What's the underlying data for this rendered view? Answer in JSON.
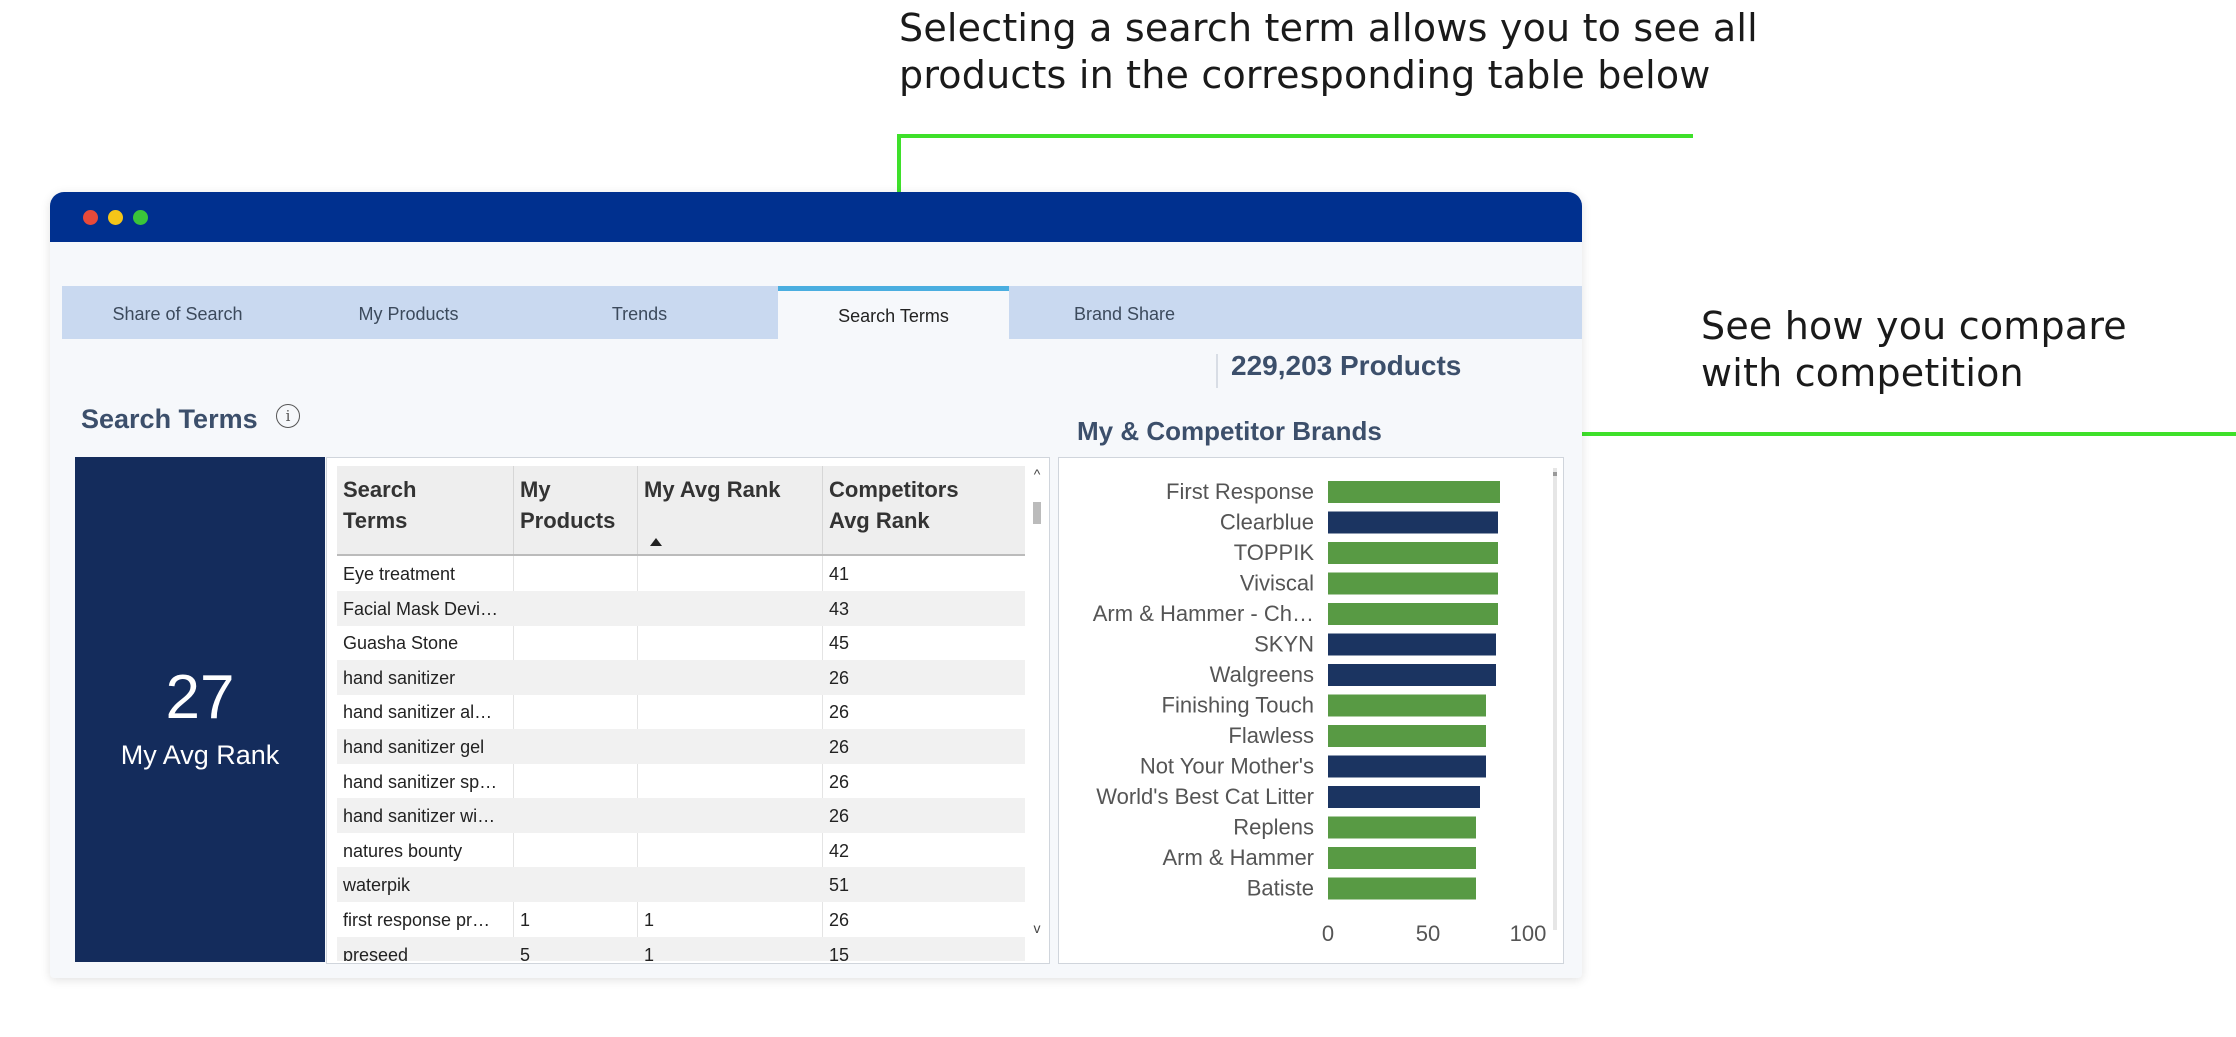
{
  "callouts": {
    "top_line1": "Selecting a search term allows you to see all",
    "top_line2": "products in the corresponding table below",
    "right_line1": "See how you compare",
    "right_line2": "with competition",
    "accent_color": "#3ee02a"
  },
  "window": {
    "titlebar_color": "#00308f",
    "dots": [
      "#e84a3a",
      "#f5c518",
      "#3ac53a"
    ]
  },
  "tabs": [
    {
      "label": "Share of Search",
      "active": false
    },
    {
      "label": "My Products",
      "active": false
    },
    {
      "label": "Trends",
      "active": false
    },
    {
      "label": "Search Terms",
      "active": true
    },
    {
      "label": "Brand Share",
      "active": false
    }
  ],
  "products_count": "229,203 Products",
  "section": {
    "title": "Search Terms",
    "info_icon": "i"
  },
  "kpi": {
    "value": "27",
    "label": "My Avg Rank"
  },
  "table": {
    "headers": [
      {
        "line1": "Search",
        "line2": "Terms"
      },
      {
        "line1": "My",
        "line2": "Products"
      },
      {
        "line1": "My Avg Rank",
        "line2": ""
      },
      {
        "line1": "Competitors",
        "line2": "Avg Rank"
      }
    ],
    "rows": [
      [
        "Eye treatment",
        "",
        "",
        "41"
      ],
      [
        "Facial Mask Devi…",
        "",
        "",
        "43"
      ],
      [
        "Guasha Stone",
        "",
        "",
        "45"
      ],
      [
        "hand sanitizer",
        "",
        "",
        "26"
      ],
      [
        "hand sanitizer al…",
        "",
        "",
        "26"
      ],
      [
        "hand sanitizer gel",
        "",
        "",
        "26"
      ],
      [
        "hand sanitizer sp…",
        "",
        "",
        "26"
      ],
      [
        "hand sanitizer wi…",
        "",
        "",
        "26"
      ],
      [
        "natures bounty",
        "",
        "",
        "42"
      ],
      [
        "waterpik",
        "",
        "",
        "51"
      ],
      [
        "first response pr…",
        "1",
        "1",
        "26"
      ],
      [
        "preseed",
        "5",
        "1",
        "15"
      ]
    ],
    "scroll_up": "^",
    "scroll_down": "v"
  },
  "chart_data": {
    "type": "bar",
    "orientation": "horizontal",
    "title": "My & Competitor Brands",
    "categories": [
      "First Response",
      "Clearblue",
      "TOPPIK",
      "Viviscal",
      "Arm & Hammer - Ch…",
      "SKYN",
      "Walgreens",
      "Finishing Touch",
      "Flawless",
      "Not Your Mother's",
      "World's Best Cat Litter",
      "Replens",
      "Arm & Hammer",
      "Batiste"
    ],
    "values": [
      86,
      85,
      85,
      85,
      85,
      84,
      84,
      79,
      79,
      79,
      76,
      74,
      74,
      74
    ],
    "bar_colors": [
      "#589a44",
      "#1b3461",
      "#589a44",
      "#589a44",
      "#589a44",
      "#1b3461",
      "#1b3461",
      "#589a44",
      "#589a44",
      "#1b3461",
      "#1b3461",
      "#589a44",
      "#589a44",
      "#589a44"
    ],
    "xlim": [
      0,
      100
    ],
    "xticks": [
      0,
      50,
      100
    ],
    "xlabel": "",
    "ylabel": ""
  }
}
